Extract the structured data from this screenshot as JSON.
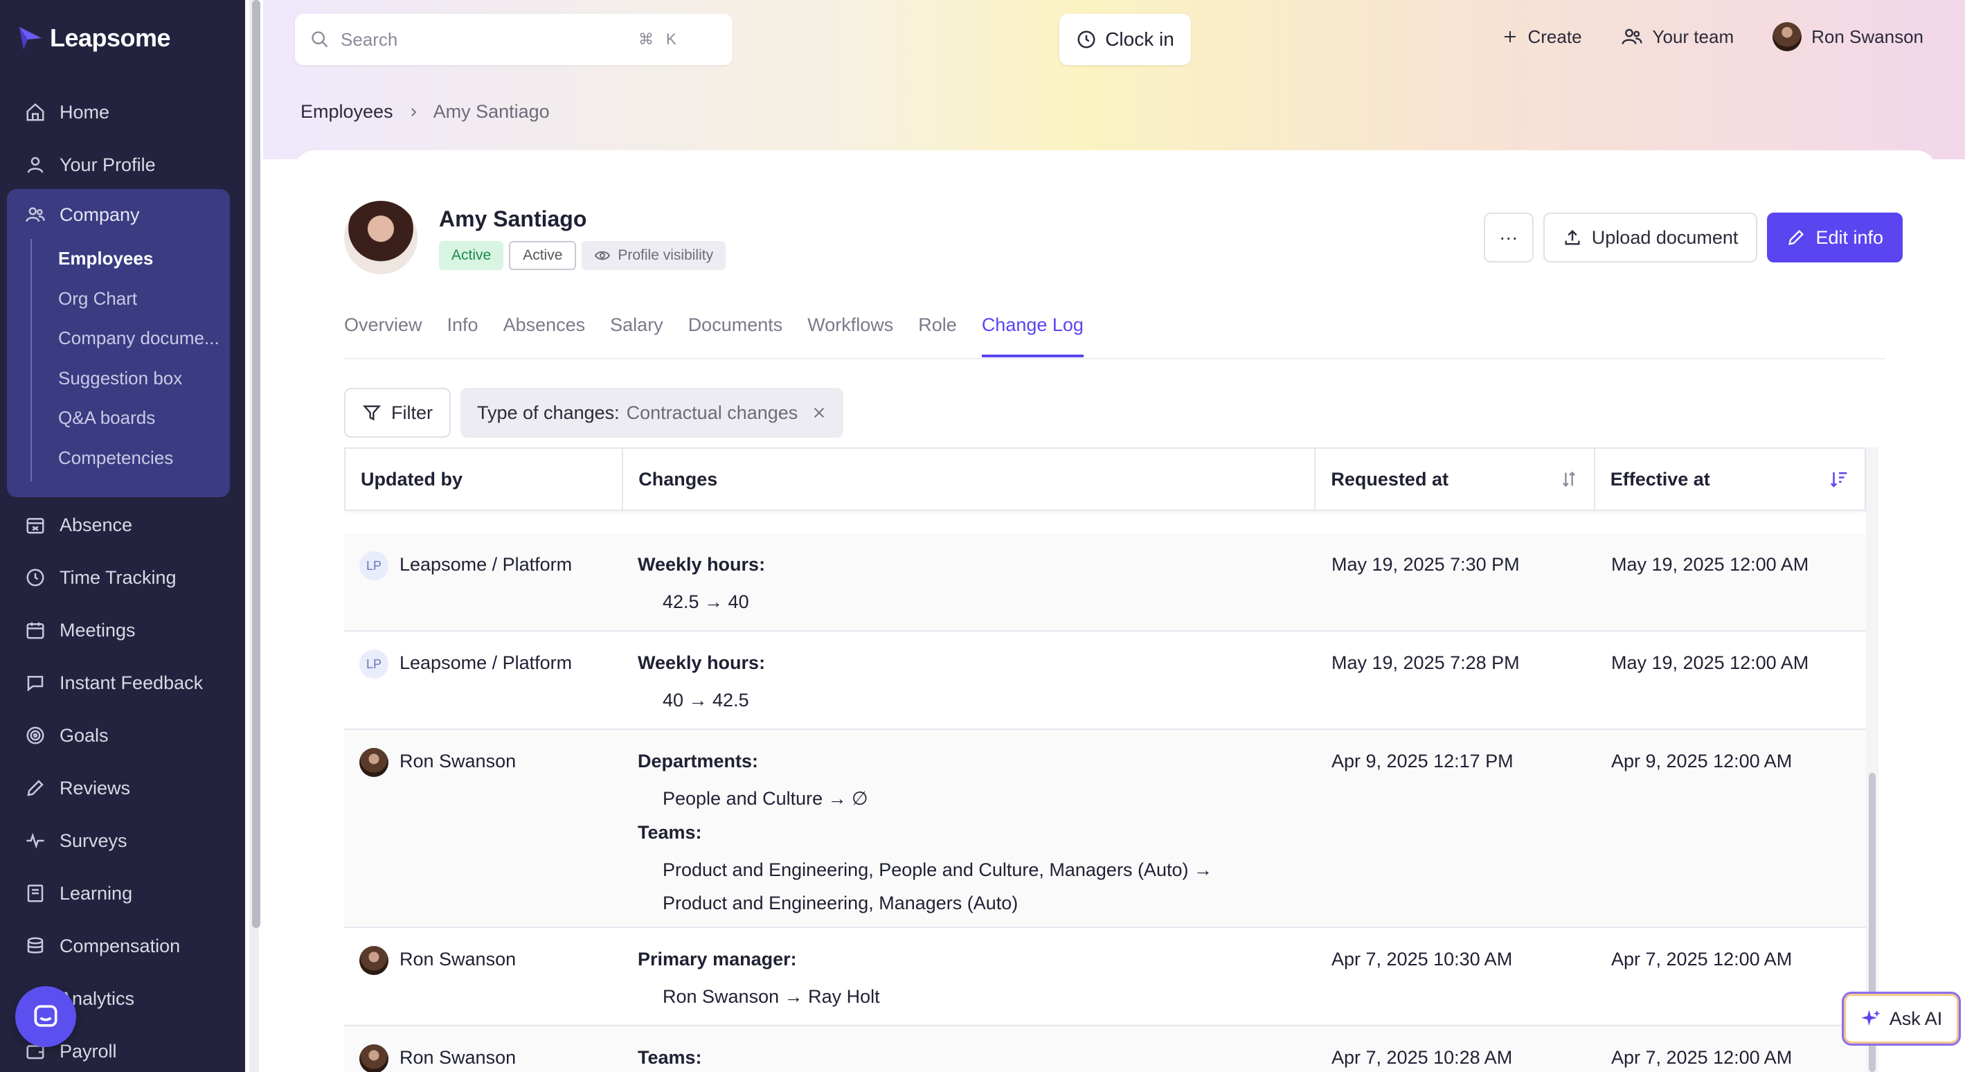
{
  "app": {
    "name": "Leapsome"
  },
  "sidebar": {
    "items_top": [
      {
        "label": "Home",
        "icon": "home-icon"
      },
      {
        "label": "Your Profile",
        "icon": "user-icon"
      }
    ],
    "company": {
      "label": "Company",
      "icon": "people-icon",
      "sub_items": [
        "Employees",
        "Org Chart",
        "Company docume...",
        "Suggestion box",
        "Q&A boards",
        "Competencies"
      ],
      "active_sub": "Employees"
    },
    "items_bottom": [
      {
        "label": "Absence",
        "icon": "calendar-x-icon"
      },
      {
        "label": "Time Tracking",
        "icon": "clock-icon"
      },
      {
        "label": "Meetings",
        "icon": "calendar-icon"
      },
      {
        "label": "Instant Feedback",
        "icon": "chat-icon"
      },
      {
        "label": "Goals",
        "icon": "target-icon"
      },
      {
        "label": "Reviews",
        "icon": "pencil-icon"
      },
      {
        "label": "Surveys",
        "icon": "pulse-icon"
      },
      {
        "label": "Learning",
        "icon": "book-icon"
      },
      {
        "label": "Compensation",
        "icon": "coins-icon"
      },
      {
        "label": "Analytics",
        "icon": "chart-icon"
      },
      {
        "label": "Payroll",
        "icon": "wallet-icon"
      }
    ]
  },
  "topbar": {
    "search_placeholder": "Search",
    "shortcut_cmd": "⌘",
    "shortcut_key": "K",
    "clock_in": "Clock in",
    "create": "Create",
    "your_team": "Your team",
    "user_name": "Ron Swanson"
  },
  "breadcrumb": {
    "parent": "Employees",
    "current": "Amy Santiago"
  },
  "profile": {
    "name": "Amy Santiago",
    "badge_active_1": "Active",
    "badge_active_2": "Active",
    "badge_visibility": "Profile visibility",
    "more": "···",
    "upload": "Upload document",
    "edit": "Edit info"
  },
  "tabs": [
    "Overview",
    "Info",
    "Absences",
    "Salary",
    "Documents",
    "Workflows",
    "Role",
    "Change Log"
  ],
  "active_tab": "Change Log",
  "filter": {
    "button": "Filter",
    "chip_key": "Type of changes:",
    "chip_value": "Contractual changes"
  },
  "table": {
    "headers": {
      "updated_by": "Updated by",
      "changes": "Changes",
      "requested_at": "Requested at",
      "effective_at": "Effective at"
    },
    "rows": [
      {
        "user": "Leapsome / Platform",
        "initials": "LP",
        "changes": [
          {
            "label": "Weekly hours:",
            "values": [
              "42.5 → 40"
            ]
          }
        ],
        "requested": "May 19, 2025 7:30 PM",
        "effective": "May 19, 2025 12:00 AM"
      },
      {
        "user": "Leapsome / Platform",
        "initials": "LP",
        "changes": [
          {
            "label": "Weekly hours:",
            "values": [
              "40 → 42.5"
            ]
          }
        ],
        "requested": "May 19, 2025 7:28 PM",
        "effective": "May 19, 2025 12:00 AM"
      },
      {
        "user": "Ron Swanson",
        "initials": "",
        "changes": [
          {
            "label": "Departments:",
            "values": [
              "People and Culture → ∅"
            ]
          },
          {
            "label": "Teams:",
            "values": [
              "Product and Engineering, People and Culture, Managers (Auto) → Product and Engineering, Managers (Auto)"
            ]
          }
        ],
        "requested": "Apr 9, 2025 12:17 PM",
        "effective": "Apr 9, 2025 12:00 AM"
      },
      {
        "user": "Ron Swanson",
        "initials": "",
        "changes": [
          {
            "label": "Primary manager:",
            "values": [
              "Ron Swanson → Ray Holt"
            ]
          }
        ],
        "requested": "Apr 7, 2025 10:30 AM",
        "effective": "Apr 7, 2025 12:00 AM"
      },
      {
        "user": "Ron Swanson",
        "initials": "",
        "changes": [
          {
            "label": "Teams:",
            "values": [
              ""
            ]
          }
        ],
        "requested": "Apr 7, 2025 10:28 AM",
        "effective": "Apr 7, 2025 12:00 AM"
      }
    ]
  },
  "ask_ai": "Ask AI",
  "colors": {
    "accent": "#5a45f0",
    "sidebar_bg": "#23233f",
    "company_block": "#3b3b82"
  }
}
